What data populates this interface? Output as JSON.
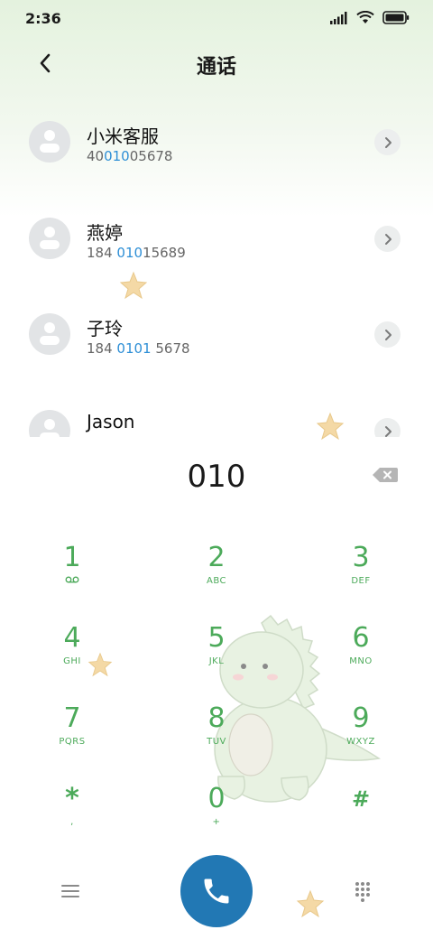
{
  "status_bar": {
    "time": "2:36"
  },
  "header": {
    "title": "通话"
  },
  "contacts": [
    {
      "name": "小米客服",
      "number_parts": [
        "40",
        "010",
        "05678"
      ]
    },
    {
      "name": "燕婷",
      "number_parts": [
        "184 ",
        "010",
        "15689"
      ]
    },
    {
      "name": "子玲",
      "number_parts": [
        "184 ",
        "0101",
        " 5678"
      ]
    },
    {
      "name": "Jason",
      "number_parts": [
        "",
        "",
        ""
      ]
    }
  ],
  "dialer": {
    "input_value": "010"
  },
  "keypad": {
    "keys": [
      {
        "digit": "1",
        "letters": ""
      },
      {
        "digit": "2",
        "letters": "ABC"
      },
      {
        "digit": "3",
        "letters": "DEF"
      },
      {
        "digit": "4",
        "letters": "GHI"
      },
      {
        "digit": "5",
        "letters": "JKL"
      },
      {
        "digit": "6",
        "letters": "MNO"
      },
      {
        "digit": "7",
        "letters": "PQRS"
      },
      {
        "digit": "8",
        "letters": "TUV"
      },
      {
        "digit": "9",
        "letters": "WXYZ"
      },
      {
        "digit": "*",
        "letters": ","
      },
      {
        "digit": "0",
        "letters": "+"
      },
      {
        "digit": "#",
        "letters": ""
      }
    ]
  },
  "colors": {
    "accent_green": "#4caa5a",
    "call_button": "#2278b4",
    "highlight_blue": "#2e8fd6"
  },
  "icons": {
    "key_1_sub": "voicemail-icon",
    "call": "phone-icon",
    "menu": "menu-icon",
    "keypad_toggle": "dialpad-icon",
    "backspace": "backspace-icon",
    "back": "chevron-left-icon",
    "detail": "chevron-right-icon"
  }
}
